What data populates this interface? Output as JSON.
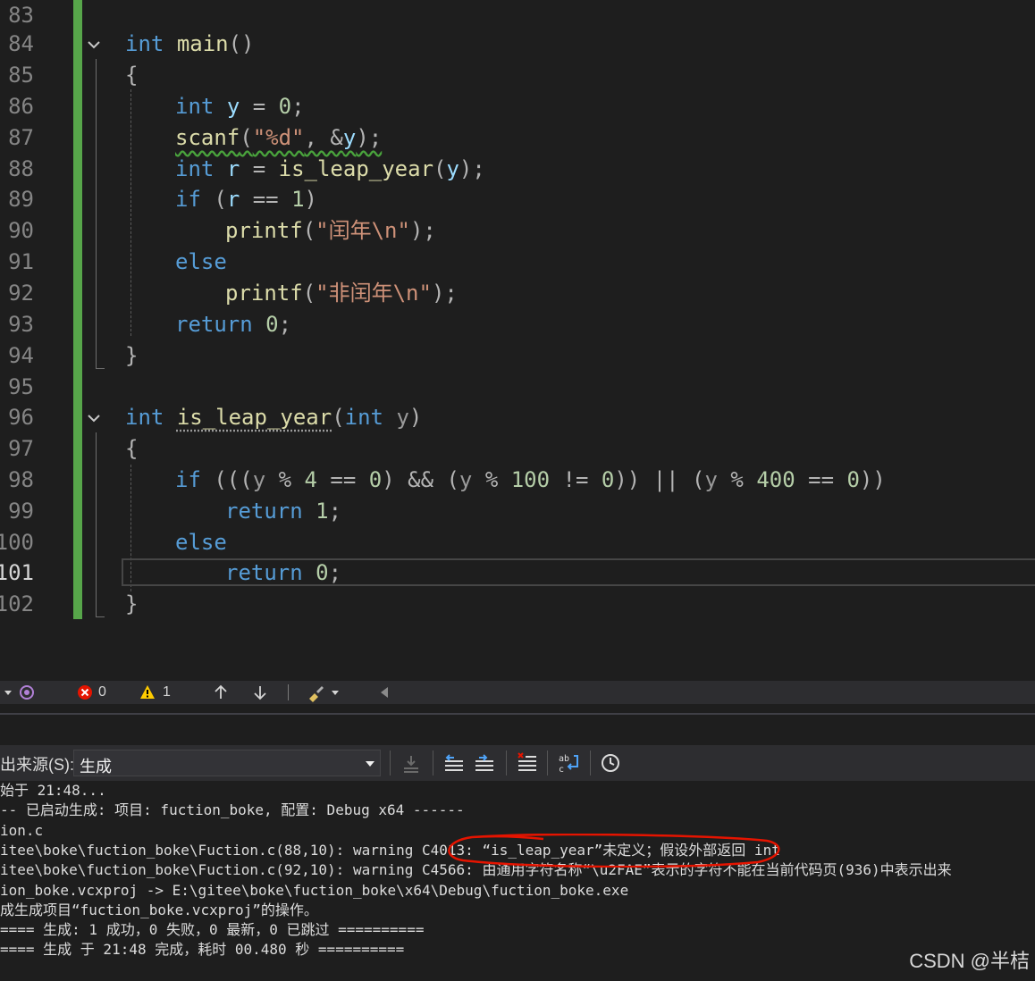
{
  "editor": {
    "line_numbers": [
      "83",
      "84",
      "85",
      "86",
      "87",
      "88",
      "89",
      "90",
      "91",
      "92",
      "93",
      "94",
      "95",
      "96",
      "97",
      "98",
      "99",
      "100",
      "101",
      "102"
    ],
    "active_line": "101",
    "lines": {
      "l84": {
        "kw": "int",
        "fn": "main",
        "rest": "()"
      },
      "l85": "{",
      "l86": {
        "kw": "int",
        "var": "y",
        "op": " = ",
        "num": "0",
        "end": ";"
      },
      "l87": {
        "fn": "scanf",
        "open": "(",
        "str": "\"%d\"",
        "mid": ", &",
        "var": "y",
        "close": ");"
      },
      "l88": {
        "kw": "int",
        "var": "r",
        "op": " = ",
        "fn": "is_leap_year",
        "open": "(",
        "var2": "y",
        "close": ");"
      },
      "l89": {
        "kw": "if",
        "open": " (",
        "var": "r",
        "op": " == ",
        "num": "1",
        "close": ")"
      },
      "l90": {
        "fn": "printf",
        "open": "(",
        "str": "\"闰年\\n\"",
        "close": ");"
      },
      "l91": {
        "kw": "else"
      },
      "l92": {
        "fn": "printf",
        "open": "(",
        "str": "\"非闰年\\n\"",
        "close": ");"
      },
      "l93": {
        "kw": "return",
        "num": "0",
        "end": ";"
      },
      "l94": "}",
      "l96": {
        "kw": "int",
        "fn": "is_leap_year",
        "open": "(",
        "kw2": "int",
        "param": "y",
        "close": ")"
      },
      "l97": "{",
      "l98": {
        "kw": "if",
        "p1": " (((",
        "v1": "y",
        "o1": " % ",
        "n1": "4",
        "o2": " == ",
        "n2": "0",
        "p2": ") && (",
        "v2": "y",
        "o3": " % ",
        "n3": "100",
        "o4": " != ",
        "n4": "0",
        "p3": ")) || (",
        "v3": "y",
        "o5": " % ",
        "n5": "400",
        "o6": " == ",
        "n6": "0",
        "p4": "))"
      },
      "l99": {
        "kw": "return",
        "num": "1",
        "end": ";"
      },
      "l100": {
        "kw": "else"
      },
      "l101": {
        "kw": "return",
        "num": "0",
        "end": ";"
      },
      "l102": "}"
    }
  },
  "statusbar": {
    "errors": "0",
    "warnings": "1"
  },
  "output": {
    "source_label": "出来源(S):",
    "source_value": "生成",
    "lines": [
      "始于 21:48...",
      "-- 已启动生成: 项目: fuction_boke, 配置: Debug x64 ------",
      "ion.c",
      "itee\\boke\\fuction_boke\\Fuction.c(88,10): warning C4013: “is_leap_year”未定义；假设外部返回 int",
      "itee\\boke\\fuction_boke\\Fuction.c(92,10): warning C4566: 由通用字符名称“\\u2FAE”表示的字符不能在当前代码页(936)中表示出来",
      "ion_boke.vcxproj -> E:\\gitee\\boke\\fuction_boke\\x64\\Debug\\fuction_boke.exe",
      "成生成项目“fuction_boke.vcxproj”的操作。",
      "==== 生成: 1 成功，0 失败，0 最新，0 已跳过 ==========",
      "==== 生成 于 21:48 完成，耗时 00.480 秒 =========="
    ]
  },
  "watermark": "CSDN @半桔",
  "colors": {
    "keyword": "#569cd6",
    "function": "#dcdcaa",
    "variable": "#9cdcfe",
    "string": "#ce9178",
    "number": "#b5cea8",
    "change_bar": "#57a64a",
    "error": "#e51400",
    "warning": "#ffcc00"
  }
}
